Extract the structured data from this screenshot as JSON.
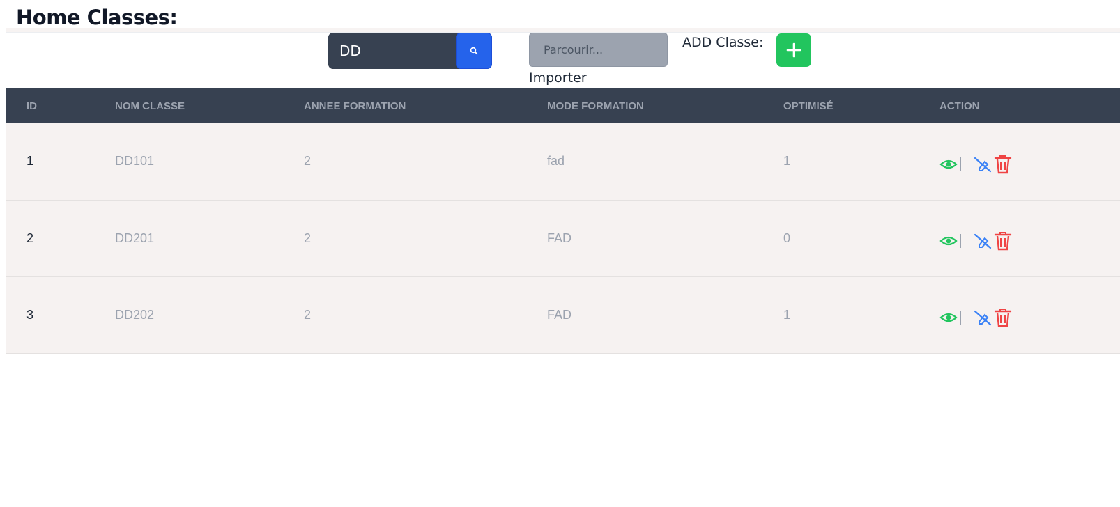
{
  "page": {
    "title": "Home Classes:"
  },
  "toolbar": {
    "search_value": "DD",
    "search_icon": "search-icon",
    "file_browse_label": "Parcourir...",
    "import_label": "Importer",
    "add_label": "ADD Classe:",
    "add_icon": "plus-icon"
  },
  "table": {
    "headers": [
      "ID",
      "NOM CLASSE",
      "ANNEE FORMATION",
      "MODE FORMATION",
      "OPTIMISÉ",
      "ACTION"
    ],
    "rows": [
      {
        "id": "1",
        "nom": "DD101",
        "annee": "2",
        "mode": "fad",
        "optimise": "1"
      },
      {
        "id": "2",
        "nom": "DD201",
        "annee": "2",
        "mode": "FAD",
        "optimise": "0"
      },
      {
        "id": "3",
        "nom": "DD202",
        "annee": "2",
        "mode": "FAD",
        "optimise": "1"
      }
    ],
    "action_icons": [
      "eye-icon",
      "edit-icon",
      "trash-icon"
    ]
  },
  "colors": {
    "header_bg": "#374151",
    "search_button": "#2563eb",
    "add_button": "#22c55e",
    "view_icon": "#22c55e",
    "edit_icon": "#3b82f6",
    "delete_icon": "#ef4444",
    "row_bg": "#f6f2f1"
  }
}
